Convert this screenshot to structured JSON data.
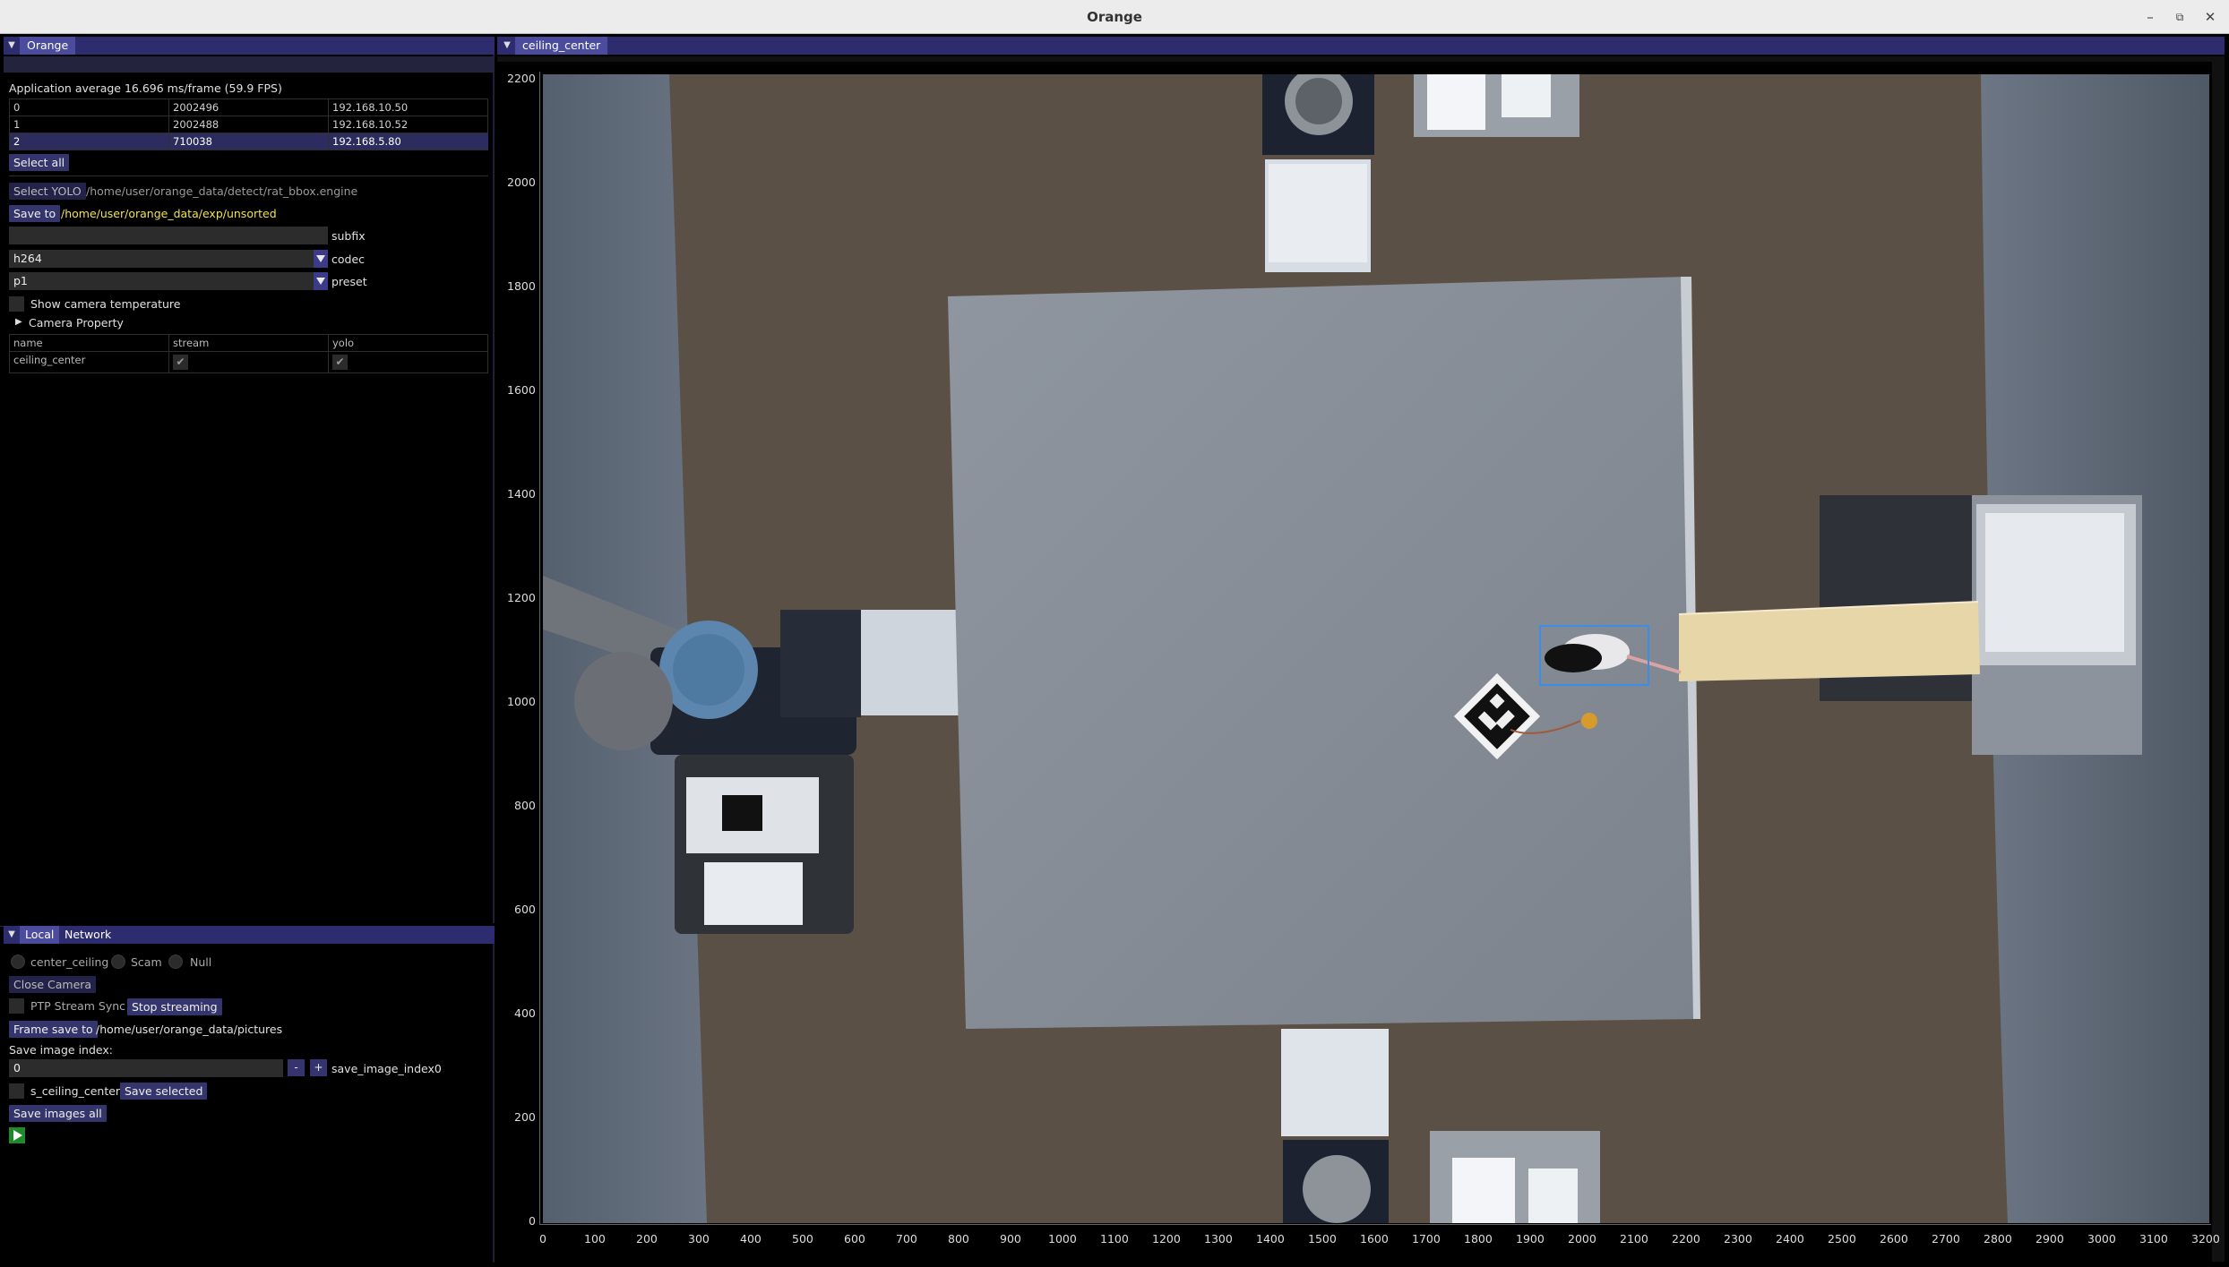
{
  "window": {
    "title": "Orange"
  },
  "left_panel": {
    "tab": "Orange",
    "fps_text": "Application average 16.696 ms/frame (59.9 FPS)",
    "devices": [
      {
        "index": "0",
        "serial": "2002496",
        "ip": "192.168.10.50"
      },
      {
        "index": "1",
        "serial": "2002488",
        "ip": "192.168.10.52"
      },
      {
        "index": "2",
        "serial": "710038",
        "ip": "192.168.5.80"
      }
    ],
    "select_all_label": "Select all",
    "select_yolo_label": "Select YOLO",
    "yolo_path": "/home/user/orange_data/detect/rat_bbox.engine",
    "save_to_label": "Save to",
    "save_path": "/home/user/orange_data/exp/unsorted",
    "subfix_value": "",
    "subfix_label": "subfix",
    "codec_value": "h264",
    "codec_label": "codec",
    "preset_value": "p1",
    "preset_label": "preset",
    "show_temp_label": "Show camera temperature",
    "camera_property_label": "Camera Property",
    "camera_table": {
      "headers": [
        "name",
        "stream",
        "yolo"
      ],
      "rows": [
        {
          "name": "ceiling_center",
          "stream": true,
          "yolo": true
        }
      ]
    }
  },
  "bottom_panel": {
    "tabs": [
      "Local",
      "Network"
    ],
    "radios": [
      "center_ceiling",
      "Scam",
      "Null"
    ],
    "close_camera_label": "Close Camera",
    "ptp_label": "PTP Stream Sync",
    "stop_streaming_label": "Stop streaming",
    "frame_save_label": "Frame save to",
    "frame_save_path": "/home/user/orange_data/pictures",
    "save_index_label": "Save image index:",
    "save_index_value": "0",
    "minus_label": "-",
    "plus_label": "+",
    "save_index_name": "save_image_index0",
    "s_ceiling_label": "s_ceiling_center",
    "save_selected_label": "Save selected",
    "save_all_label": "Save images all",
    "play_icon": "play-icon"
  },
  "view_panel": {
    "tab": "ceiling_center",
    "x_ticks": [
      "0",
      "100",
      "200",
      "300",
      "400",
      "500",
      "600",
      "700",
      "800",
      "900",
      "1000",
      "1100",
      "1200",
      "1300",
      "1400",
      "1500",
      "1600",
      "1700",
      "1800",
      "1900",
      "2000",
      "2100",
      "2200",
      "2300",
      "2400",
      "2500",
      "2600",
      "2700",
      "2800",
      "2900",
      "3000",
      "3100",
      "3200"
    ],
    "y_ticks": [
      "2200",
      "2000",
      "1800",
      "1600",
      "1400",
      "1200",
      "1000",
      "800",
      "600",
      "400",
      "200",
      "0"
    ],
    "detection_color": "#3a8ee6"
  }
}
